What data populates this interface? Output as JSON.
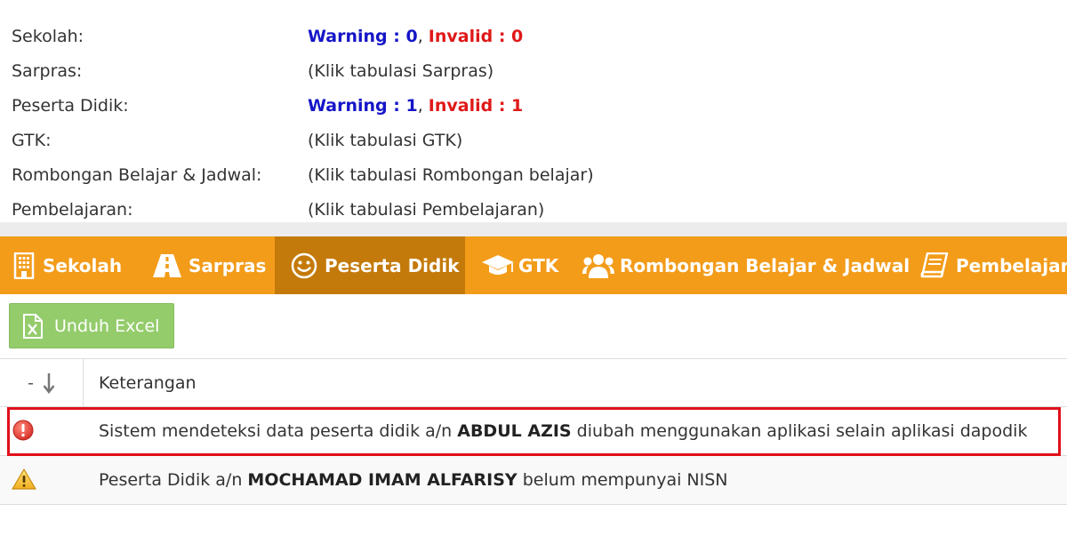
{
  "summary": {
    "rows": [
      {
        "label": "Sekolah:",
        "warning": "Warning : 0",
        "invalid": "Invalid : 0"
      },
      {
        "label": "Sarpras:",
        "text": "(Klik tabulasi Sarpras)"
      },
      {
        "label": "Peserta Didik:",
        "warning": "Warning : 1",
        "invalid": "Invalid : 1"
      },
      {
        "label": "GTK:",
        "text": "(Klik tabulasi GTK)"
      },
      {
        "label": "Rombongan Belajar & Jadwal:",
        "text": "(Klik tabulasi Rombongan belajar)"
      },
      {
        "label": "Pembelajaran:",
        "text": "(Klik tabulasi Pembelajaran)"
      }
    ],
    "separator": ","
  },
  "tabs": [
    {
      "label": "Sekolah",
      "icon": "building-icon"
    },
    {
      "label": "Sarpras",
      "icon": "road-icon"
    },
    {
      "label": "Peserta Didik",
      "icon": "smile-icon",
      "active": true
    },
    {
      "label": "GTK",
      "icon": "graduation-cap-icon"
    },
    {
      "label": "Rombongan Belajar & Jadwal",
      "icon": "users-icon"
    },
    {
      "label": "Pembelajaran",
      "icon": "book-icon"
    }
  ],
  "toolbar": {
    "excel_label": "Unduh Excel",
    "excel_icon": "excel-file-icon"
  },
  "table": {
    "sort_label": "-",
    "sort_icon": "arrow-down-icon",
    "column": "Keterangan",
    "rows": [
      {
        "icon": "error-icon",
        "before": "Sistem mendeteksi data peserta didik a/n ",
        "name": "ABDUL AZIS",
        "after": " diubah menggunakan aplikasi selain aplikasi dapodik"
      },
      {
        "icon": "warning-icon",
        "before": "Peserta Didik a/n ",
        "name": "MOCHAMAD IMAM ALFARISY",
        "after": " belum mempunyai NISN"
      }
    ]
  },
  "colors": {
    "tab_bar": "#f39c1a",
    "tab_active": "#c47a0a",
    "warning": "#1515c8",
    "invalid": "#e01818",
    "excel_button": "#94cc6c",
    "highlight": "#e0101a"
  }
}
